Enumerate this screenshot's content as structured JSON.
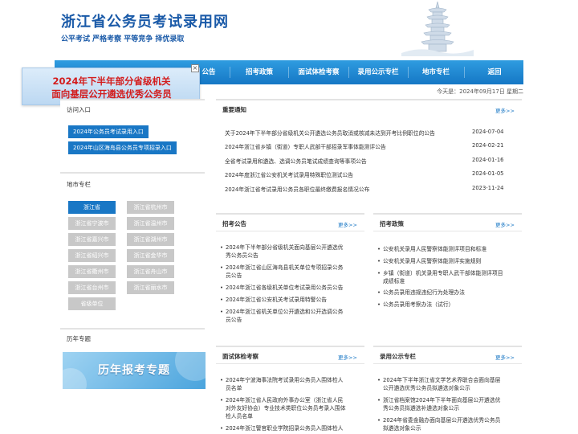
{
  "header": {
    "title": "浙江省公务员考试录用网",
    "slogan": "公平考试  严格考察  平等竞争  择优录取"
  },
  "nav": {
    "items": [
      "公告",
      "招考政策",
      "面试体检考察",
      "录用公示专栏",
      "地市专栏",
      "返回"
    ]
  },
  "float_banner": {
    "line1": "2024年下半年部分省级机关",
    "line2": "面向基层公开遴选优秀公务员",
    "close": "×"
  },
  "date_line": "今天是：2024年09月17日 星期二",
  "entry": {
    "title": "访问入口",
    "buttons": [
      "2024年公务员考试录用入口",
      "2024年山区海岛县公务员专项招录入口"
    ]
  },
  "cities": {
    "title": "地市专栏",
    "items": [
      "浙江省",
      "浙江省杭州市",
      "浙江省宁波市",
      "浙江省温州市",
      "浙江省嘉兴市",
      "浙江省湖州市",
      "浙江省绍兴市",
      "浙江省金华市",
      "浙江省衢州市",
      "浙江省舟山市",
      "浙江省台州市",
      "浙江省丽水市",
      "省级单位"
    ]
  },
  "history": {
    "title": "历年专题",
    "banner": "历年报考专题"
  },
  "notices": {
    "title": "重要通知",
    "more": "更多>>",
    "rows": [
      {
        "text": "关于2024年下半年部分省级机关公开遴选公务员取消或核减未达到开考比例职位的公告",
        "date": "2024-07-04"
      },
      {
        "text": "2024年浙江省乡镇（街道）专职人武部干部招录军事体能测评公告",
        "date": "2024-02-21"
      },
      {
        "text": "全省考试录用和遴选、选调公务员笔试成绩查询等事项公告",
        "date": "2024-01-16"
      },
      {
        "text": "2024年度浙江省公安机关考试录用特殊职位测试公告",
        "date": "2024-01-05"
      },
      {
        "text": "2024年浙江省考试录用公务员各职位最终缴费报名情况公布",
        "date": "2023-11-24"
      }
    ]
  },
  "announcements": {
    "title": "招考公告",
    "more": "更多>>",
    "items": [
      {
        "l1": "2024年下半年部分省级机关面向基层公开遴选优",
        "l2": "秀公务员公告"
      },
      {
        "l1": "2024年浙江省山区海岛县机关单位专项招录公务",
        "l2": "员公告"
      },
      {
        "l1": "2024年浙江省各级机关单位考试录用公务员公告",
        "l2": ""
      },
      {
        "l1": "2024年浙江省公安机关考试录用特警公告",
        "l2": ""
      },
      {
        "l1": "2024年浙江省机关单位公开遴选和公开选调公务",
        "l2": "员公告"
      }
    ]
  },
  "policies": {
    "title": "招考政策",
    "more": "更多>>",
    "items": [
      {
        "l1": "公安机关录用人民警察体能测评项目和标准",
        "l2": ""
      },
      {
        "l1": "公安机关录用人民警察体能测评实施规则",
        "l2": ""
      },
      {
        "l1": "乡镇（街道）机关录用专职人武干部体能测评项目",
        "l2": "成绩标准"
      },
      {
        "l1": "公务员录用违规违纪行为处理办法",
        "l2": ""
      },
      {
        "l1": "公务员录用考察办法（试行）",
        "l2": ""
      }
    ]
  },
  "interview": {
    "title": "面试体检考察",
    "more": "更多>>",
    "items": [
      {
        "l1": "2024年宁波海事法院考试录用公务员入围体检人",
        "l2": "员名单"
      },
      {
        "l1": "2024年浙江省人民政府外事办公室（浙江省人民",
        "l2": "对外友好协会）专业技术类职位公务员考录入围体",
        "l3": "检人员名单"
      },
      {
        "l1": "2024年浙江警官职业学院招录公务员入围体检人",
        "l2": ""
      }
    ]
  },
  "publicity": {
    "title": "录用公示专栏",
    "more": "更多>>",
    "items": [
      {
        "l1": "2024年下半年浙江省文学艺术界联合会面向基层",
        "l2": "公开遴选优秀公务员拟遴选对象公示"
      },
      {
        "l1": "浙江省档案馆2024年下半年面向基层公开遴选优",
        "l2": "秀公务员拟遴选补遴选对象公示"
      },
      {
        "l1": "2024年省委金融办面向基层公开遴选优秀公务员",
        "l2": "拟遴选对象公示"
      }
    ]
  }
}
